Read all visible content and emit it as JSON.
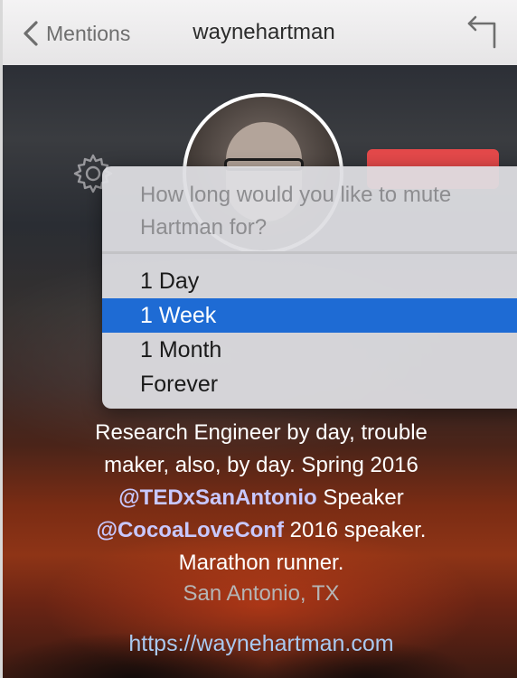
{
  "titlebar": {
    "back_label": "Mentions",
    "title": "waynehartman"
  },
  "icons": {
    "back": "chevron-left-icon",
    "reply": "reply-arrow-icon",
    "settings": "gear-icon"
  },
  "mute_menu": {
    "prompt_line1": "How long would you like to mute",
    "prompt_line2": "Hartman for?",
    "options": [
      {
        "label": "1 Day"
      },
      {
        "label": "1 Week",
        "selected": true
      },
      {
        "label": "1 Month"
      },
      {
        "label": "Forever"
      }
    ]
  },
  "profile": {
    "bio_line1": "Research Engineer by day, trouble",
    "bio_line2": "maker, also, by day.  Spring 2016",
    "handle1": "@TEDxSanAntonio",
    "handle1_suffix": " Speaker",
    "handle2": "@CocoaLoveConf",
    "handle2_suffix": " 2016 speaker.",
    "bio_line5": "Marathon runner.",
    "location": "San Antonio, TX",
    "url": "https://waynehartman.com"
  },
  "colors": {
    "follow_button": "#e4494a",
    "selected_item": "#1e6bd4",
    "handle": "#c8c8ff",
    "link": "#a9c9f0"
  }
}
